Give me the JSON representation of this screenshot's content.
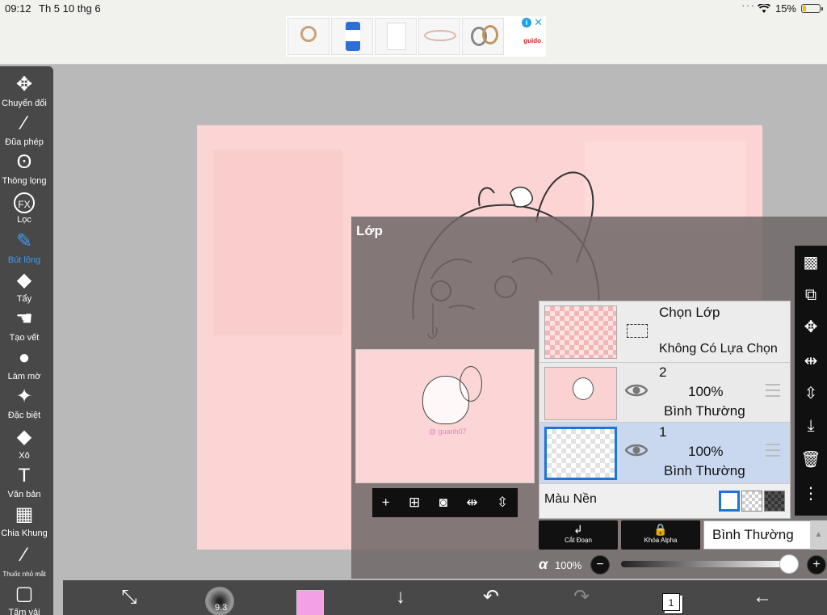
{
  "status": {
    "time": "09:12",
    "date": "Th 5 10 thg 6",
    "battery": "15%"
  },
  "ad": {
    "brand": "guido"
  },
  "tools": [
    {
      "label": "Chuyển đổi",
      "icon": "move-icon",
      "glyph": "✥"
    },
    {
      "label": "Đũa phép",
      "icon": "magic-wand-icon",
      "glyph": "⁄"
    },
    {
      "label": "Thòng lọng",
      "icon": "lasso-icon",
      "glyph": "ʘ"
    },
    {
      "label": "Lọc",
      "icon": "fx-icon",
      "glyph": "FX"
    },
    {
      "label": "Bút lông",
      "icon": "brush-icon",
      "glyph": "✎",
      "active": true
    },
    {
      "label": "Tẩy",
      "icon": "eraser-icon",
      "glyph": "◆"
    },
    {
      "label": "Tạo vết",
      "icon": "smudge-icon",
      "glyph": "☚"
    },
    {
      "label": "Làm mờ",
      "icon": "blur-icon",
      "glyph": "●"
    },
    {
      "label": "Đặc biệt",
      "icon": "special-icon",
      "glyph": "✦"
    },
    {
      "label": "Xô",
      "icon": "bucket-icon",
      "glyph": "◆"
    },
    {
      "label": "Văn bản",
      "icon": "text-icon",
      "glyph": "T"
    },
    {
      "label": "Chia Khung",
      "icon": "frame-divider-icon",
      "glyph": "▦"
    },
    {
      "label": "Thuốc nhỏ mắt",
      "icon": "eyedropper-icon",
      "glyph": "⁄"
    },
    {
      "label": "Tấm vải",
      "icon": "canvas-icon",
      "glyph": "▢"
    }
  ],
  "layer_panel": {
    "title": "Lớp",
    "watermark": "@ guanh07",
    "selection_row": {
      "title": "Chọn Lớp",
      "subtitle": "Không Có Lựa Chọn"
    },
    "layers": [
      {
        "name": "2",
        "opacity": "100%",
        "blend": "Bình Thường"
      },
      {
        "name": "1",
        "opacity": "100%",
        "blend": "Bình Thường"
      }
    ],
    "background_label": "Màu Nền",
    "clip_label": "Cắt Đoạn",
    "alpha_lock_label": "Khóa Alpha",
    "blend_mode": "Bình Thường",
    "alpha_symbol": "α",
    "alpha_value": "100%"
  },
  "bottom": {
    "brush_size": "9.3",
    "layer_count": "1"
  },
  "colors": {
    "accent": "#1e74d6",
    "active_tool": "#3e9bf2",
    "brush_color": "#f4a0e6",
    "canvas": "#fcd4d4"
  }
}
